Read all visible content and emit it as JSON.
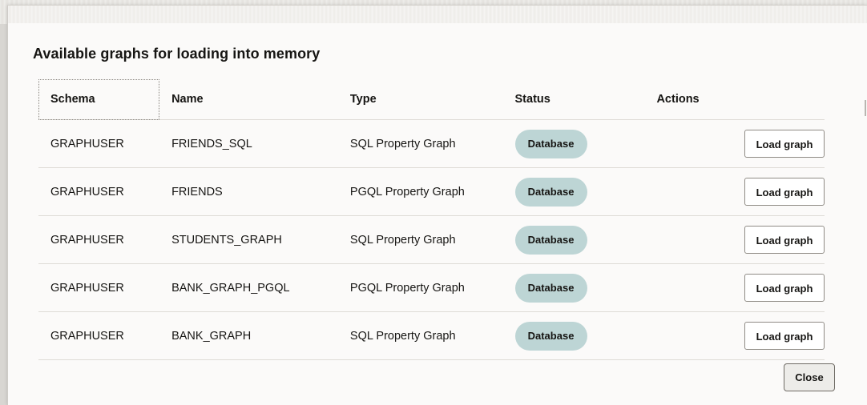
{
  "dialog": {
    "title": "Available graphs for loading into memory",
    "close_label": "Close"
  },
  "table": {
    "headers": {
      "schema": "Schema",
      "name": "Name",
      "type": "Type",
      "status": "Status",
      "actions": "Actions"
    },
    "rows": [
      {
        "schema": "GRAPHUSER",
        "name": "FRIENDS_SQL",
        "type": "SQL Property Graph",
        "status": "Database",
        "action": "Load graph"
      },
      {
        "schema": "GRAPHUSER",
        "name": "FRIENDS",
        "type": "PGQL Property Graph",
        "status": "Database",
        "action": "Load graph"
      },
      {
        "schema": "GRAPHUSER",
        "name": "STUDENTS_GRAPH",
        "type": "SQL Property Graph",
        "status": "Database",
        "action": "Load graph"
      },
      {
        "schema": "GRAPHUSER",
        "name": "BANK_GRAPH_PGQL",
        "type": "PGQL Property Graph",
        "status": "Database",
        "action": "Load graph"
      },
      {
        "schema": "GRAPHUSER",
        "name": "BANK_GRAPH",
        "type": "SQL Property Graph",
        "status": "Database",
        "action": "Load graph"
      }
    ]
  },
  "colors": {
    "status_badge": "#bdd5d5",
    "dialog_background": "#fbfaf9",
    "text": "#161513"
  }
}
